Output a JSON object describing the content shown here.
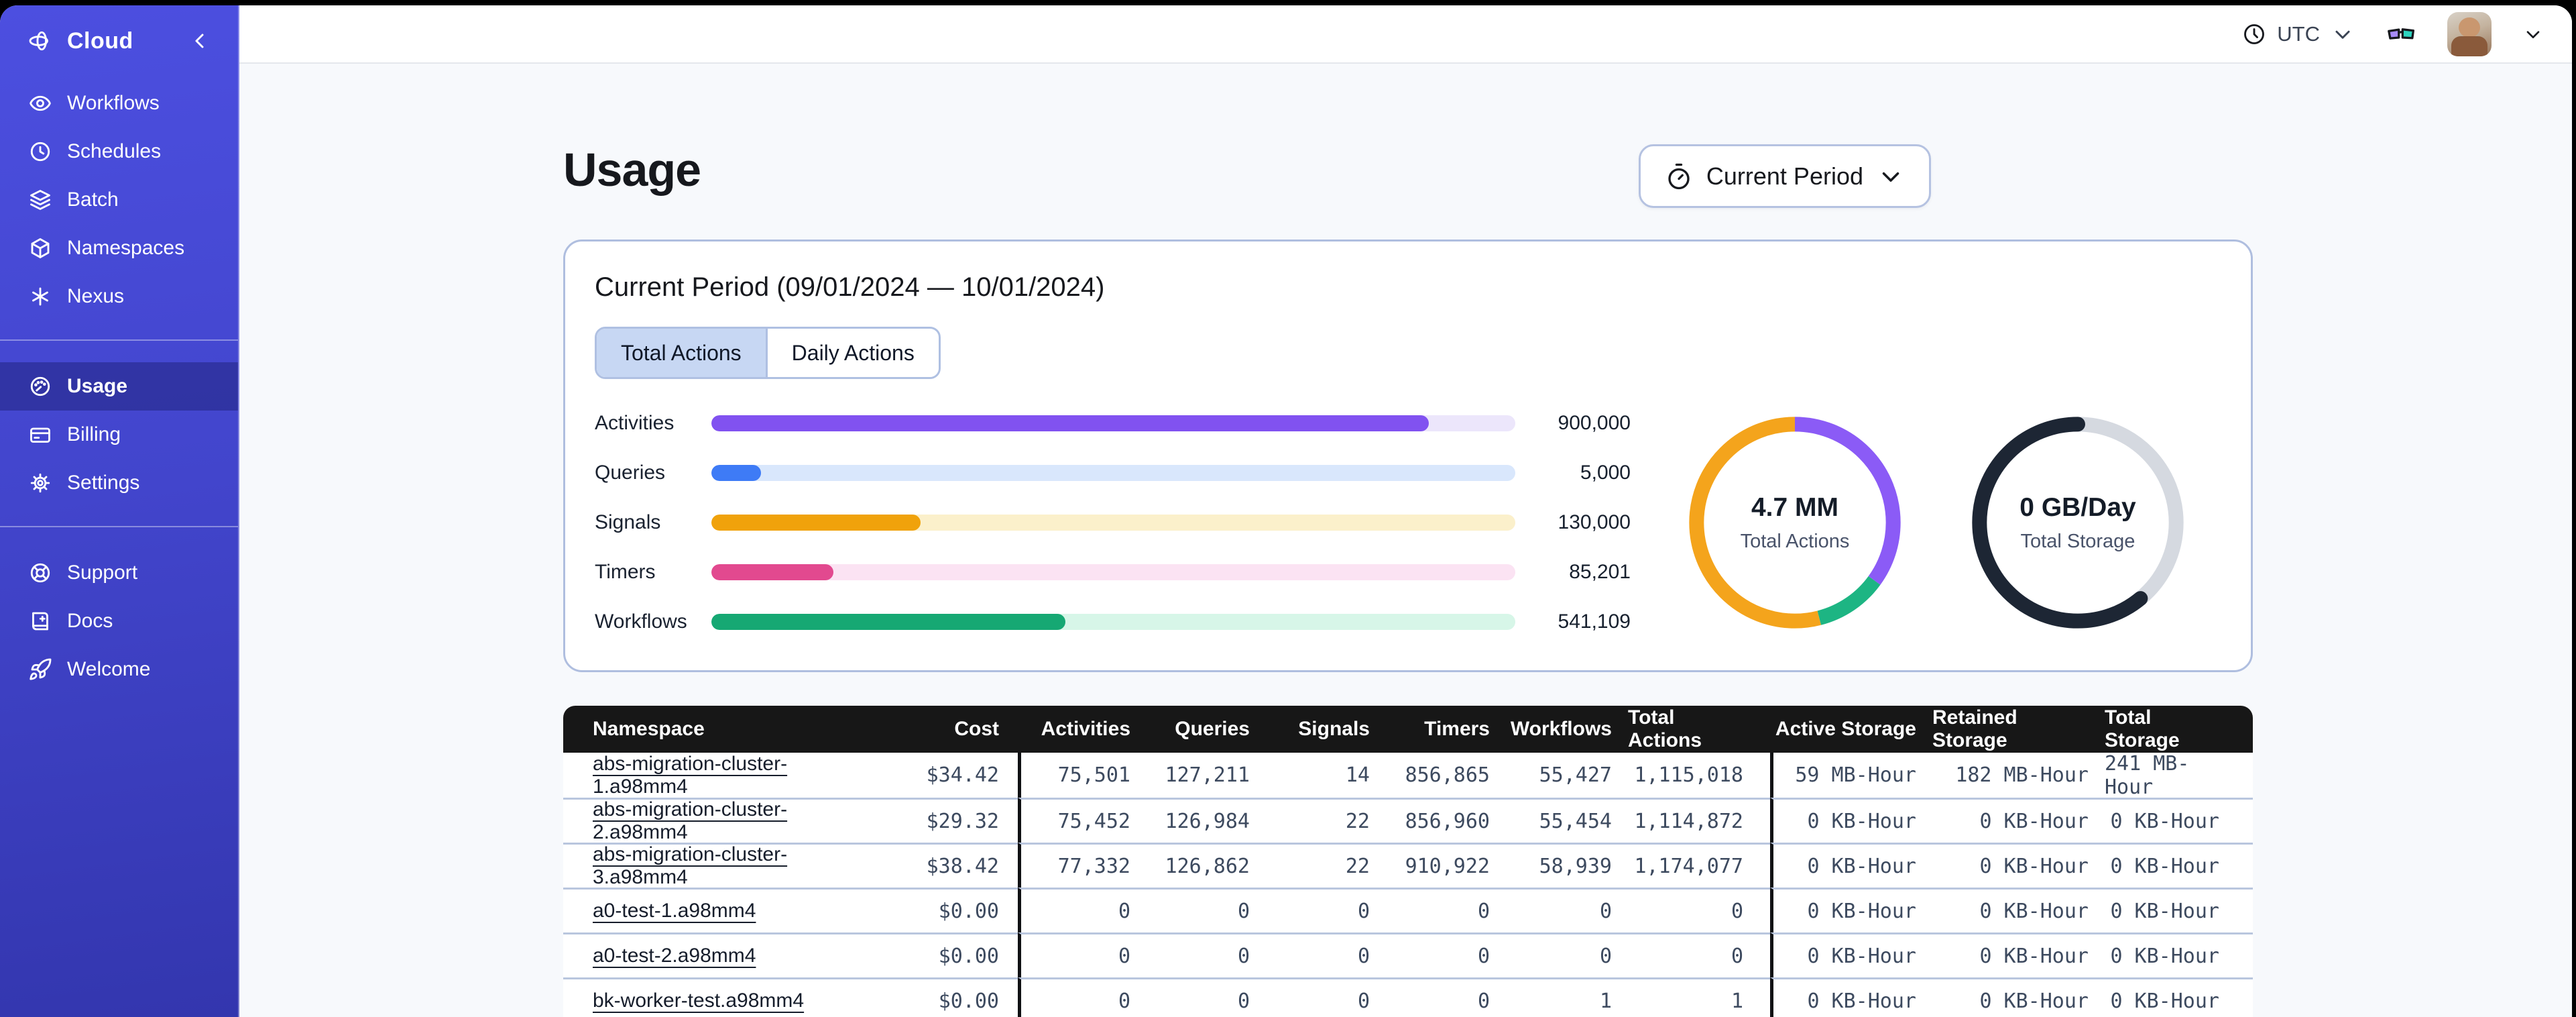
{
  "sidebar": {
    "logo": {
      "icon": "temporal-logo-icon",
      "label": "Cloud",
      "collapse_icon": "chevron-left-icon"
    },
    "groups": [
      {
        "items": [
          {
            "icon": "workflows-icon",
            "label": "Workflows",
            "active": false
          },
          {
            "icon": "schedules-icon",
            "label": "Schedules",
            "active": false
          },
          {
            "icon": "batch-icon",
            "label": "Batch",
            "active": false
          },
          {
            "icon": "namespaces-icon",
            "label": "Namespaces",
            "active": false
          },
          {
            "icon": "nexus-icon",
            "label": "Nexus",
            "active": false
          }
        ]
      },
      {
        "items": [
          {
            "icon": "usage-icon",
            "label": "Usage",
            "active": true
          },
          {
            "icon": "billing-icon",
            "label": "Billing",
            "active": false
          },
          {
            "icon": "settings-icon",
            "label": "Settings",
            "active": false
          }
        ]
      },
      {
        "items": [
          {
            "icon": "support-icon",
            "label": "Support",
            "active": false
          },
          {
            "icon": "docs-icon",
            "label": "Docs",
            "active": false
          },
          {
            "icon": "welcome-icon",
            "label": "Welcome",
            "active": false
          }
        ]
      }
    ]
  },
  "topbar": {
    "timezone_label": "UTC"
  },
  "page": {
    "title": "Usage",
    "period_button_label": "Current Period"
  },
  "card": {
    "title": "Current Period (09/01/2024 — 10/01/2024)",
    "tabs": [
      {
        "label": "Total Actions",
        "active": true
      },
      {
        "label": "Daily Actions",
        "active": false
      }
    ]
  },
  "chart_data": [
    {
      "type": "bar",
      "title": "Total Actions by type, current period",
      "categories": [
        "Activities",
        "Queries",
        "Signals",
        "Timers",
        "Workflows"
      ],
      "values": [
        900000,
        5000,
        130000,
        85201,
        541109
      ],
      "display_values": [
        "900,000",
        "5,000",
        "130,000",
        "85,201",
        "541,109"
      ],
      "fill_fractions": [
        0.892,
        0.062,
        0.26,
        0.152,
        0.44
      ],
      "bar_colors": [
        "#8152F0",
        "#3E7BF6",
        "#F0A20B",
        "#E2498F",
        "#16A873"
      ],
      "track_colors": [
        "#ECE6FB",
        "#D9E7FC",
        "#FBF0CB",
        "#FBE3F3",
        "#D7F6E8"
      ],
      "xlabel": "",
      "ylabel": "",
      "legend": "none",
      "grid": false
    },
    {
      "type": "pie",
      "title": "Total Actions donut",
      "center_value": "4.7 MM",
      "center_label": "Total Actions",
      "segments": [
        {
          "name": "purple-segment",
          "color": "#8B5BF6",
          "fraction": 0.35
        },
        {
          "name": "green-segment",
          "color": "#1DB583",
          "fraction": 0.11
        },
        {
          "name": "orange-segment",
          "color": "#F4A41C",
          "fraction": 0.54
        }
      ],
      "rounded_caps": false
    },
    {
      "type": "pie",
      "title": "Total Storage donut",
      "center_value": "0 GB/Day",
      "center_label": "Total Storage",
      "segments": [
        {
          "name": "gray-segment",
          "color": "#D5D9E0",
          "fraction": 0.39
        },
        {
          "name": "dark-segment",
          "color": "#1D2634",
          "fraction": 0.61
        }
      ],
      "rounded_caps": true
    }
  ],
  "table": {
    "columns": [
      "Namespace",
      "Cost",
      "Activities",
      "Queries",
      "Signals",
      "Timers",
      "Workflows",
      "Total Actions",
      "Active Storage",
      "Retained Storage",
      "Total Storage"
    ],
    "rows": [
      [
        "abs-migration-cluster-1.a98mm4",
        "$34.42",
        "75,501",
        "127,211",
        "14",
        "856,865",
        "55,427",
        "1,115,018",
        "59 MB-Hour",
        "182 MB-Hour",
        "241 MB-Hour"
      ],
      [
        "abs-migration-cluster-2.a98mm4",
        "$29.32",
        "75,452",
        "126,984",
        "22",
        "856,960",
        "55,454",
        "1,114,872",
        "0 KB-Hour",
        "0 KB-Hour",
        "0 KB-Hour"
      ],
      [
        "abs-migration-cluster-3.a98mm4",
        "$38.42",
        "77,332",
        "126,862",
        "22",
        "910,922",
        "58,939",
        "1,174,077",
        "0 KB-Hour",
        "0 KB-Hour",
        "0 KB-Hour"
      ],
      [
        "a0-test-1.a98mm4",
        "$0.00",
        "0",
        "0",
        "0",
        "0",
        "0",
        "0",
        "0 KB-Hour",
        "0 KB-Hour",
        "0 KB-Hour"
      ],
      [
        "a0-test-2.a98mm4",
        "$0.00",
        "0",
        "0",
        "0",
        "0",
        "0",
        "0",
        "0 KB-Hour",
        "0 KB-Hour",
        "0 KB-Hour"
      ],
      [
        "bk-worker-test.a98mm4",
        "$0.00",
        "0",
        "0",
        "0",
        "0",
        "1",
        "1",
        "0 KB-Hour",
        "0 KB-Hour",
        "0 KB-Hour"
      ]
    ]
  }
}
